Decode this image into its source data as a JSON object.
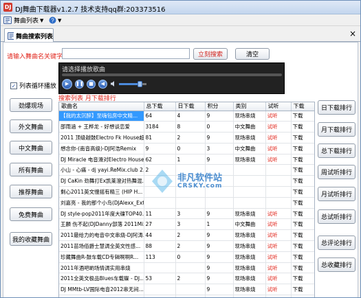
{
  "window": {
    "title": "DJ舞曲下载器v1.2.7  技术支持qq群:203373516"
  },
  "menubar": {
    "items": [
      {
        "label": "舞曲列表",
        "icon": "music-list-icon"
      },
      {
        "label": "",
        "icon": "help-icon"
      }
    ]
  },
  "tab": {
    "label": "舞曲搜索列表",
    "close": "×"
  },
  "search": {
    "label": "请输入舞曲名关键字:",
    "value": "",
    "placeholder": "",
    "search_button": "立刻搜索",
    "clear_button": "清空"
  },
  "loop_checkbox": {
    "label": "列表循环播放",
    "checked": true
  },
  "player": {
    "title": "请选择播放歌曲",
    "progress": 0,
    "volume": 0.75
  },
  "list_caption": "搜索列表 月下载排行",
  "left_categories": [
    "劲爆现场",
    "外文舞曲",
    "中文舞曲",
    "所有舞曲",
    "推荐舞曲",
    "免费舞曲",
    "我的收藏舞曲"
  ],
  "right_rankings": [
    "日下载排行",
    "月下载排行",
    "总下载排行",
    "周试听排行",
    "月试听排行",
    "总试听排行",
    "总评论排行",
    "总收藏排行"
  ],
  "table": {
    "columns": [
      "歌曲名",
      "总下载",
      "日下载",
      "积分",
      "类别",
      "试听",
      "下载"
    ],
    "rows": [
      {
        "name": "【我的太沉醉】至嗨包房中文精...",
        "total": "64",
        "day": "4",
        "points": "9",
        "category": "现场串烧",
        "listen": "试听",
        "download": "下载",
        "selected": true
      },
      {
        "name": "邵雨涵 + 王桦龙 - 好想谈恋爱",
        "total": "3184",
        "day": "8",
        "points": "0",
        "category": "中文舞曲",
        "listen": "试听",
        "download": "下载"
      },
      {
        "name": "2011 顶级越鼓Electro Fk House超...",
        "total": "81",
        "day": "2",
        "points": "9",
        "category": "现场串烧",
        "listen": "试听",
        "download": "下载"
      },
      {
        "name": "想念你-(南音高级)-DJ阿浩Remix",
        "total": "9",
        "day": "0",
        "points": "3",
        "category": "中文舞曲",
        "listen": "试听",
        "download": "下载"
      },
      {
        "name": "DJ Miracle 电音滑对Electro House...",
        "total": "62",
        "day": "1",
        "points": "9",
        "category": "现场串烧",
        "listen": "试听",
        "download": "下载"
      },
      {
        "name": "小山 - 心痛 - dj yayi.ReMix.club 2...",
        "total": "2",
        "day": "",
        "points": "",
        "category": "",
        "listen": "",
        "download": "下载"
      },
      {
        "name": "DJ CaKin 劲舞打Ex凯莱澄对热舞混...",
        "total": "",
        "day": "",
        "points": "",
        "category": "",
        "listen": "",
        "download": "下载"
      },
      {
        "name": "剩心2011英文慢摇有精三 (HIP H...",
        "total": "",
        "day": "",
        "points": "",
        "category": "",
        "listen": "",
        "download": "下载"
      },
      {
        "name": "刘嘉亮 - 我的那个小鸟(DJAlexx_Ext...",
        "total": "",
        "day": "",
        "points": "",
        "category": "",
        "listen": "",
        "download": "下载"
      },
      {
        "name": "DJ style-pop2011年度大碟TOP40...",
        "total": "11",
        "day": "3",
        "points": "9",
        "category": "现场串烧",
        "listen": "试听",
        "download": "下载"
      },
      {
        "name": "王麟 伤不起(DJDanny部落 2011Mix)",
        "total": "27",
        "day": "3",
        "points": "1",
        "category": "中文舞曲",
        "listen": "试听",
        "download": "下载"
      },
      {
        "name": "2011最给力的电音中文串烧-DJ阿涛...",
        "total": "44",
        "day": "2",
        "points": "9",
        "category": "现场串烧",
        "listen": "试听",
        "download": "下载"
      },
      {
        "name": "2011苗场佰爵士慧调全英文性感...",
        "total": "88",
        "day": "2",
        "points": "9",
        "category": "现场串烧",
        "listen": "试听",
        "download": "下载"
      },
      {
        "name": "珍藏舞曲R-鼓车载CD专辑啊啊R...",
        "total": "113",
        "day": "0",
        "points": "9",
        "category": "现场串烧",
        "listen": "试听",
        "download": "下载"
      },
      {
        "name": "2011年酒吧啲场情调实用串烧",
        "total": "",
        "day": "",
        "points": "9",
        "category": "现场串烧",
        "listen": "试听",
        "download": "下载"
      },
      {
        "name": "2011全英文极品Blues车载碟 - DJ...",
        "total": "53",
        "day": "2",
        "points": "9",
        "category": "现场串烧",
        "listen": "试听",
        "download": "下载"
      },
      {
        "name": "DJ MMtb-LV国际电音2012串无间...",
        "total": "",
        "day": "",
        "points": "9",
        "category": "现场串烧",
        "listen": "试听",
        "download": "下载"
      },
      {
        "name": "DJ CaKin 绝对特爆Electro House...",
        "total": "170",
        "day": "0",
        "points": "9",
        "category": "现场串烧",
        "listen": "试听",
        "download": "下载"
      }
    ]
  },
  "watermark": {
    "cn": "非凡软件站",
    "en": "CRSKY.com"
  },
  "colors": {
    "accent_red": "#e1261c",
    "selection_blue": "#3399ff"
  }
}
